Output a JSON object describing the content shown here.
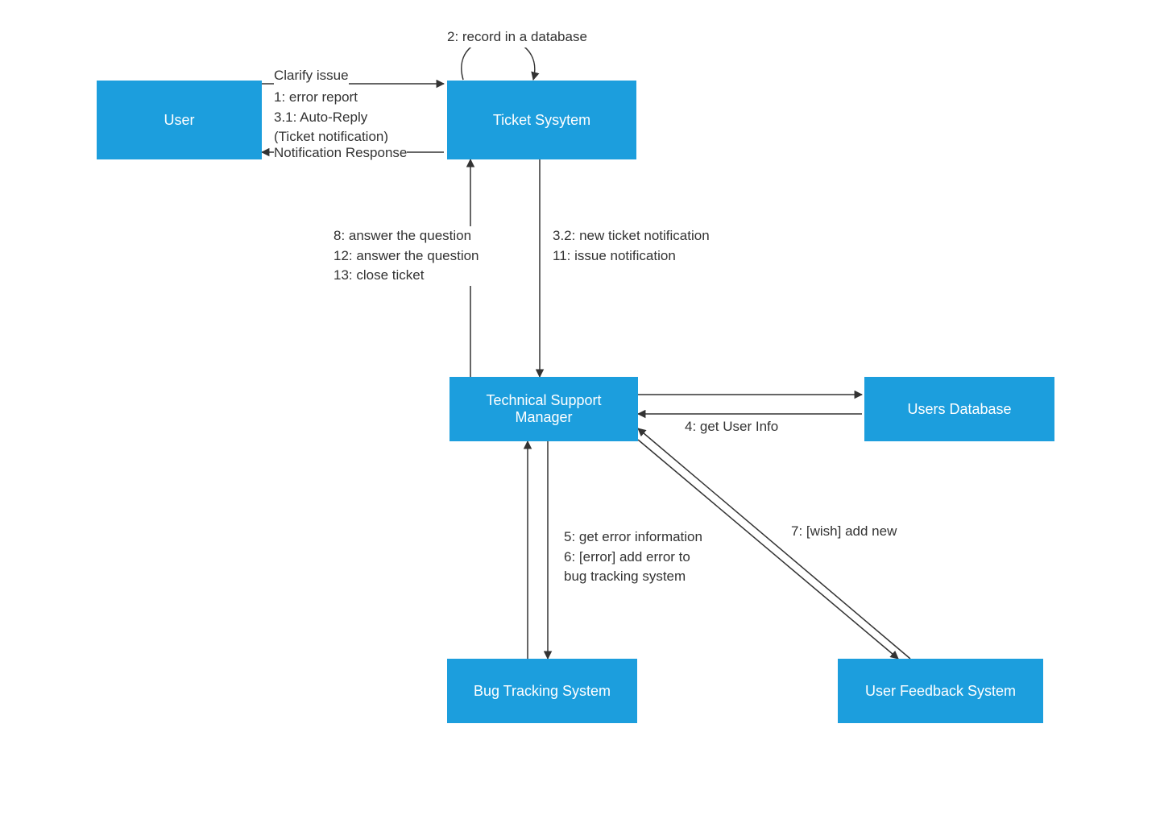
{
  "nodes": {
    "user": {
      "label": "User"
    },
    "ticketSystem": {
      "label": "Ticket Sysytem"
    },
    "tsm": {
      "label": "Technical Support\nManager"
    },
    "usersDb": {
      "label": "Users Database"
    },
    "bugTracking": {
      "label": "Bug Tracking System"
    },
    "userFeedback": {
      "label": "User Feedback System"
    }
  },
  "edges": {
    "clarifyIssue": {
      "label": "Clarify issue"
    },
    "errorReportAutoReply": {
      "label": "1: error report\n3.1: Auto-Reply\n(Ticket notification)"
    },
    "notificationResponse": {
      "label": "Notification Response"
    },
    "recordInDb": {
      "label": "2: record in a database"
    },
    "toTsm": {
      "label": "3.2: new ticket notification\n11: issue notification"
    },
    "toTicketSystem": {
      "label": "8: answer the question\n12: answer the question\n13: close ticket"
    },
    "getUserInfo": {
      "label": "4: get User Info"
    },
    "bugTrackingInfo": {
      "label": "5: get error information\n6: [error] add error to\nbug tracking system"
    },
    "wishAddNew": {
      "label": "7: [wish] add new"
    }
  },
  "colors": {
    "node": "#1c9edd",
    "arrow": "#333333"
  }
}
